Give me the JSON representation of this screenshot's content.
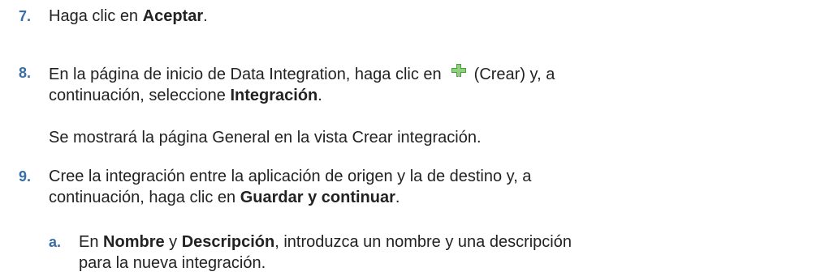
{
  "steps": [
    {
      "number": "7.",
      "pre": "Haga clic en ",
      "bold": "Aceptar",
      "post": "."
    },
    {
      "number": "8.",
      "pre": "En la página de inicio de Data Integration, haga clic en",
      "icon": "plus-icon",
      "mid": "(Crear) y, a continuación, seleccione ",
      "bold": "Integración",
      "post": ".",
      "note": "Se mostrará la página General en la vista Crear integración."
    },
    {
      "number": "9.",
      "pre": "Cree la integración entre la aplicación de origen y la de destino y, a continuación, haga clic en ",
      "bold": "Guardar y continuar",
      "post": ".",
      "substeps": [
        {
          "letter": "a.",
          "pre": "En ",
          "bold1": "Nombre",
          "mid": " y ",
          "bold2": "Descripción",
          "post": ", introduzca un nombre y una descripción para la nueva integración."
        }
      ]
    }
  ],
  "colors": {
    "step_number": "#3a6ea5",
    "text": "#222222",
    "icon_green": "#4aa03c"
  }
}
